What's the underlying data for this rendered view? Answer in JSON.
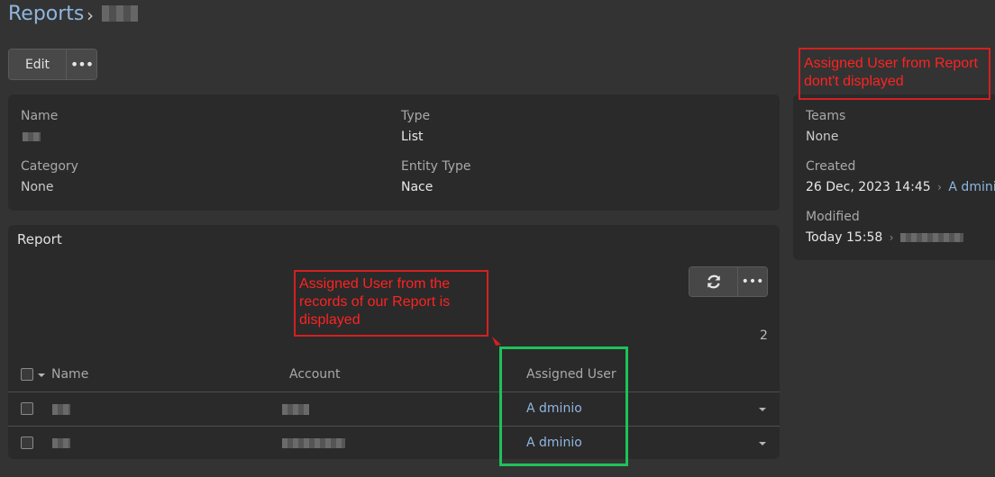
{
  "breadcrumb": {
    "root": "Reports",
    "separator": "›"
  },
  "toolbar": {
    "edit_label": "Edit",
    "more_label": "•••"
  },
  "details": {
    "name_label": "Name",
    "type_label": "Type",
    "type_value": "List",
    "category_label": "Category",
    "category_value": "None",
    "entity_type_label": "Entity Type",
    "entity_type_value": "Nace"
  },
  "side": {
    "teams_label": "Teams",
    "teams_value": "None",
    "created_label": "Created",
    "created_value": "26 Dec, 2023 14:45",
    "created_sep": "›",
    "created_user": "A dminio",
    "modified_label": "Modified",
    "modified_value": "Today 15:58",
    "modified_sep": "›"
  },
  "report": {
    "title": "Report",
    "count": "2",
    "more_label": "•••",
    "columns": {
      "name": "Name",
      "account": "Account",
      "assigned_user": "Assigned User"
    },
    "rows": [
      {
        "assigned_user": "A dminio"
      },
      {
        "assigned_user": "A dminio"
      }
    ]
  },
  "annotations": {
    "side_note": "Assigned User from Report dont't displayed",
    "table_note": "Assigned User from the records of our Report is displayed"
  },
  "colors": {
    "link": "#8fb6e0",
    "annotation_red": "#ff2222",
    "annotation_green": "#1ec25a",
    "background": "#333333",
    "panel": "#2a2a2a"
  }
}
